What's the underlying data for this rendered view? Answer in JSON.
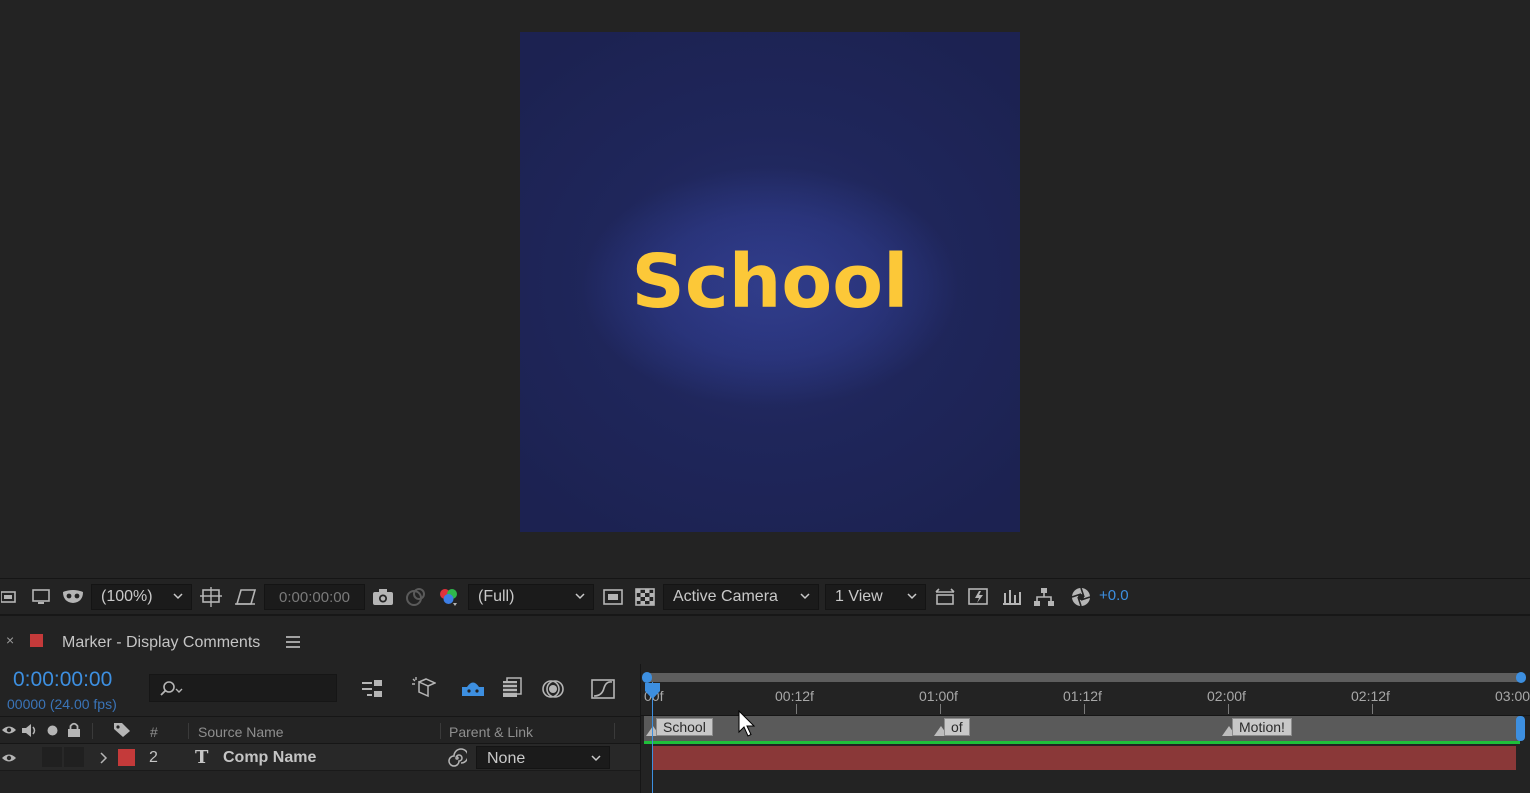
{
  "viewer": {
    "canvas_text": "School",
    "colors": {
      "canvas_text": "#fcc838",
      "canvas_bg": "#2b3680"
    }
  },
  "viewer_toolbar": {
    "magnification": "(100%)",
    "current_time": "0:00:00:00",
    "resolution": "(Full)",
    "view_camera": "Active Camera",
    "view_layout": "1 View",
    "exposure": "+0.0",
    "icons": [
      "always-preview-icon",
      "monitor-icon",
      "mask-icon",
      "region-of-interest-icon",
      "transparency-grid-toggle-icon",
      "snapshot-icon",
      "show-snapshot-icon",
      "color-channels-icon",
      "fast-previews-icon",
      "toggle-transparency-icon",
      "reset-exposure-icon",
      "flowchart-icon"
    ]
  },
  "timeline": {
    "tab_title": "Marker - Display Comments",
    "timecode": "0:00:00:00",
    "frame_info": "00000 (24.00 fps)",
    "search_placeholder": "",
    "header": {
      "number_col": "#",
      "source_name": "Source Name",
      "parent_link": "Parent & Link"
    },
    "layer": {
      "index": "2",
      "type_glyph": "T",
      "name": "Comp Name",
      "parent": "None",
      "color": "#c43a3a"
    },
    "ruler": [
      "00f",
      "00:12f",
      "01:00f",
      "01:12f",
      "02:00f",
      "02:12f",
      "03:00"
    ],
    "markers": [
      "School",
      "of",
      "Motion!"
    ]
  }
}
